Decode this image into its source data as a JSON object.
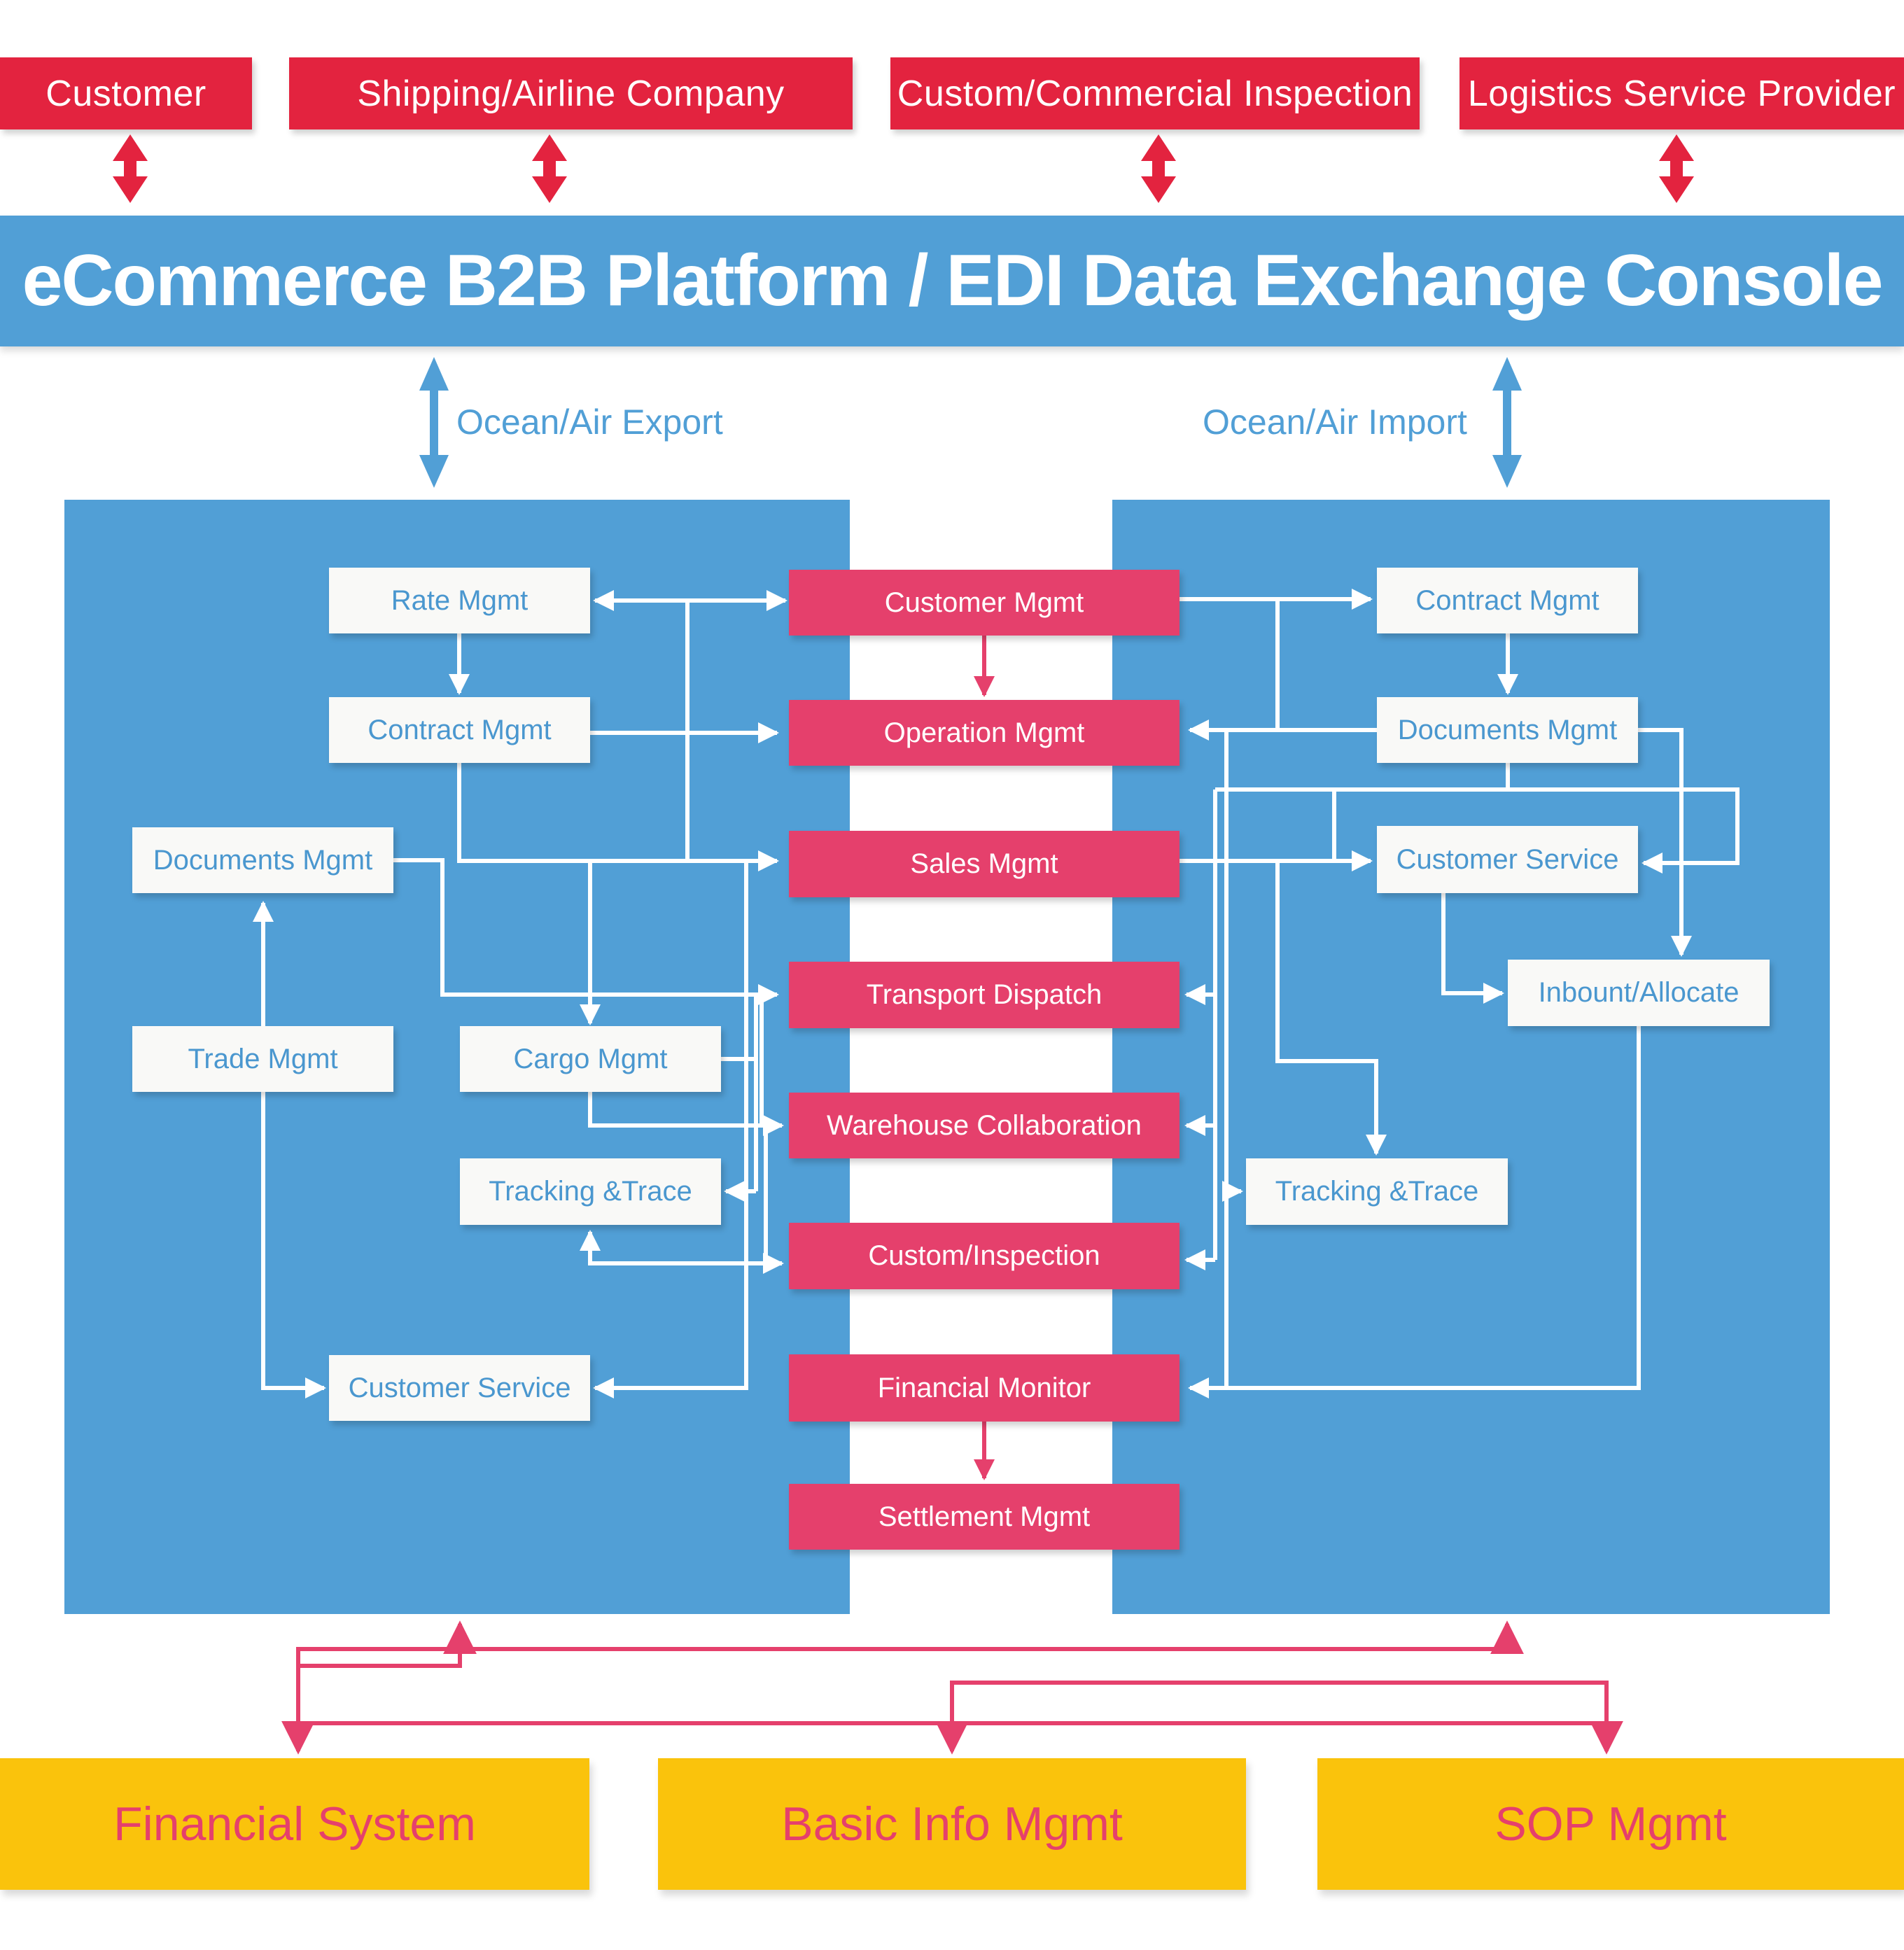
{
  "external_parties": [
    {
      "label": "Customer"
    },
    {
      "label": "Shipping/Airline Company"
    },
    {
      "label": "Custom/Commercial Inspection"
    },
    {
      "label": "Logistics Service Provider"
    }
  ],
  "banner": {
    "title": "eCommerce B2B Platform / EDI Data Exchange Console"
  },
  "flows": {
    "export_label": "Ocean/Air Export",
    "import_label": "Ocean/Air Import"
  },
  "export_panel": {
    "modules": [
      {
        "id": "rate",
        "label": "Rate Mgmt"
      },
      {
        "id": "contract",
        "label": "Contract Mgmt"
      },
      {
        "id": "documents",
        "label": "Documents Mgmt"
      },
      {
        "id": "trade",
        "label": "Trade Mgmt"
      },
      {
        "id": "cargo",
        "label": "Cargo Mgmt"
      },
      {
        "id": "tracking",
        "label": "Tracking &Trace"
      },
      {
        "id": "customer_service",
        "label": "Customer Service"
      }
    ]
  },
  "core_modules": [
    {
      "id": "customer",
      "label": "Customer Mgmt"
    },
    {
      "id": "operation",
      "label": "Operation Mgmt"
    },
    {
      "id": "sales",
      "label": "Sales Mgmt"
    },
    {
      "id": "transport",
      "label": "Transport Dispatch"
    },
    {
      "id": "warehouse",
      "label": "Warehouse Collaboration"
    },
    {
      "id": "custom",
      "label": "Custom/Inspection"
    },
    {
      "id": "financial_monitor",
      "label": "Financial Monitor"
    },
    {
      "id": "settlement",
      "label": "Settlement Mgmt"
    }
  ],
  "import_panel": {
    "modules": [
      {
        "id": "contract",
        "label": "Contract Mgmt"
      },
      {
        "id": "documents",
        "label": "Documents Mgmt"
      },
      {
        "id": "customer_service",
        "label": "Customer Service"
      },
      {
        "id": "inbound",
        "label": "Inbount/Allocate"
      },
      {
        "id": "tracking",
        "label": "Tracking &Trace"
      }
    ]
  },
  "support_systems": [
    {
      "label": "Financial System"
    },
    {
      "label": "Basic Info Mgmt"
    },
    {
      "label": "SOP Mgmt"
    }
  ],
  "colors": {
    "external_red": "#e3233f",
    "platform_blue": "#519fd6",
    "core_pink": "#e5406c",
    "support_yellow": "#fac30c",
    "module_white": "#f9f9f7"
  }
}
